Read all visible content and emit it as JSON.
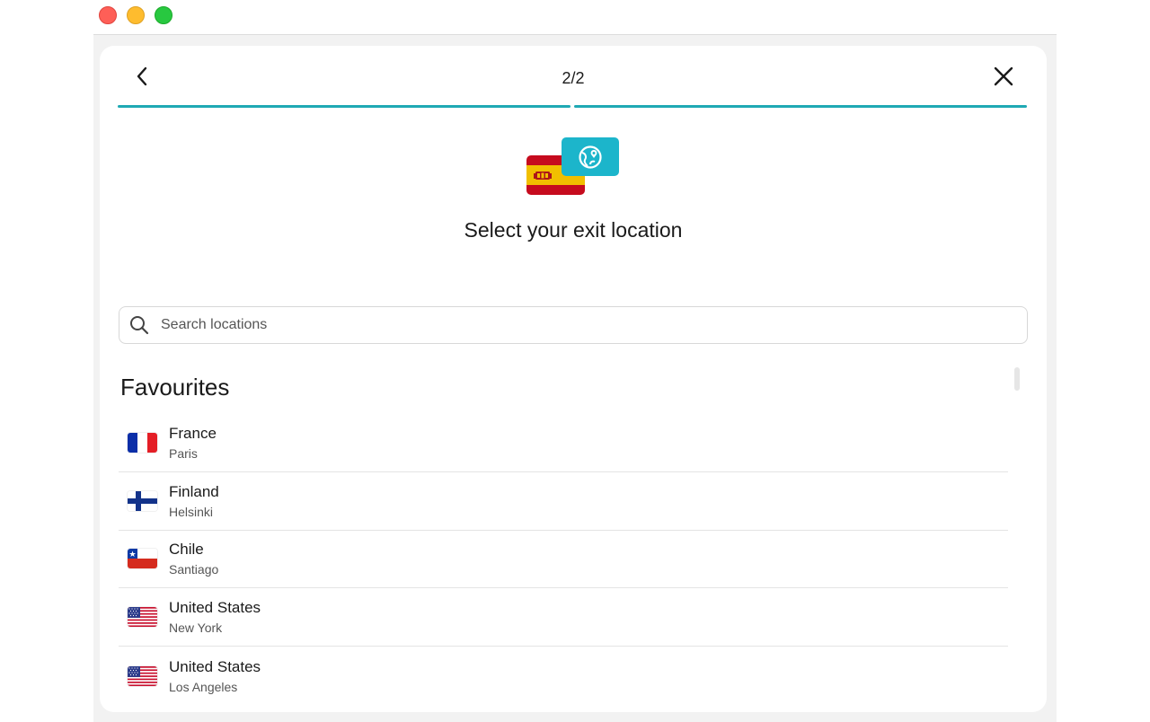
{
  "window": {
    "controls": [
      "close",
      "minimize",
      "maximize"
    ]
  },
  "header": {
    "step": "2/2",
    "back_icon": "chevron-left-icon",
    "close_icon": "close-icon",
    "progress_color": "#1fa9b4"
  },
  "hero": {
    "flag_icon": "spain-flag-icon",
    "globe_icon": "globe-pin-icon",
    "accent": "#1cb5cb",
    "title": "Select your exit location"
  },
  "search": {
    "placeholder": "Search locations",
    "value": "",
    "icon": "search-icon"
  },
  "favourites": {
    "heading": "Favourites",
    "items": [
      {
        "country": "France",
        "city": "Paris",
        "flag": "france-flag-icon"
      },
      {
        "country": "Finland",
        "city": "Helsinki",
        "flag": "finland-flag-icon"
      },
      {
        "country": "Chile",
        "city": "Santiago",
        "flag": "chile-flag-icon"
      },
      {
        "country": "United States",
        "city": "New York",
        "flag": "us-flag-icon"
      },
      {
        "country": "United States",
        "city": "Los Angeles",
        "flag": "us-flag-icon"
      }
    ]
  }
}
